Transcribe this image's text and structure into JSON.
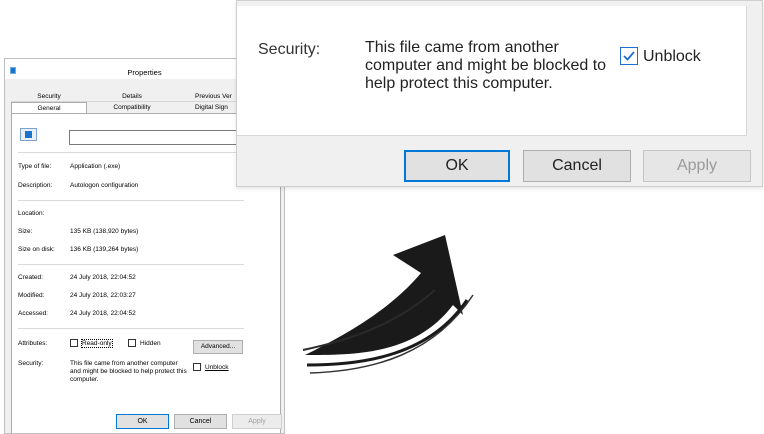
{
  "dialog": {
    "title": "Properties",
    "tabs_row1": [
      "Security",
      "Details",
      "Previous Ver"
    ],
    "tabs_row2": [
      "General",
      "Compatibility",
      "Digital Sign"
    ],
    "active_tab": "General",
    "file_name_value": "",
    "fields": {
      "type_label": "Type of file:",
      "type_value": "Application (.exe)",
      "description_label": "Description:",
      "description_value": "Autologon configuration",
      "location_label": "Location:",
      "location_value": "",
      "size_label": "Size:",
      "size_value": "135 KB (138,920 bytes)",
      "size_on_disk_label": "Size on disk:",
      "size_on_disk_value": "136 KB (139,264 bytes)",
      "created_label": "Created:",
      "created_value": "24 July 2018, 22:04:52",
      "modified_label": "Modified:",
      "modified_value": "24 July 2018, 22:03:27",
      "accessed_label": "Accessed:",
      "accessed_value": "24 July 2018, 22:04:52"
    },
    "attributes": {
      "label": "Attributes:",
      "read_only": "Read-only",
      "hidden": "Hidden",
      "advanced_button": "Advanced..."
    },
    "security": {
      "label": "Security:",
      "text": "This file came from another computer and might be blocked to help protect this computer.",
      "unblock": "Unblock"
    },
    "buttons": {
      "ok": "OK",
      "cancel": "Cancel",
      "apply": "Apply"
    }
  },
  "zoom": {
    "security_label": "Security:",
    "security_text": "This file came from another computer and might be blocked to help protect this computer.",
    "unblock_label": "Unblock",
    "unblock_checked": true,
    "buttons": {
      "ok": "OK",
      "cancel": "Cancel",
      "apply": "Apply"
    }
  },
  "colors": {
    "accent": "#0078d7",
    "check": "#1d6fd6",
    "arrow": "#1a1a1a"
  },
  "icons": {
    "app": "application-icon",
    "arrow": "curved-arrow-icon",
    "check": "checkmark-icon"
  }
}
